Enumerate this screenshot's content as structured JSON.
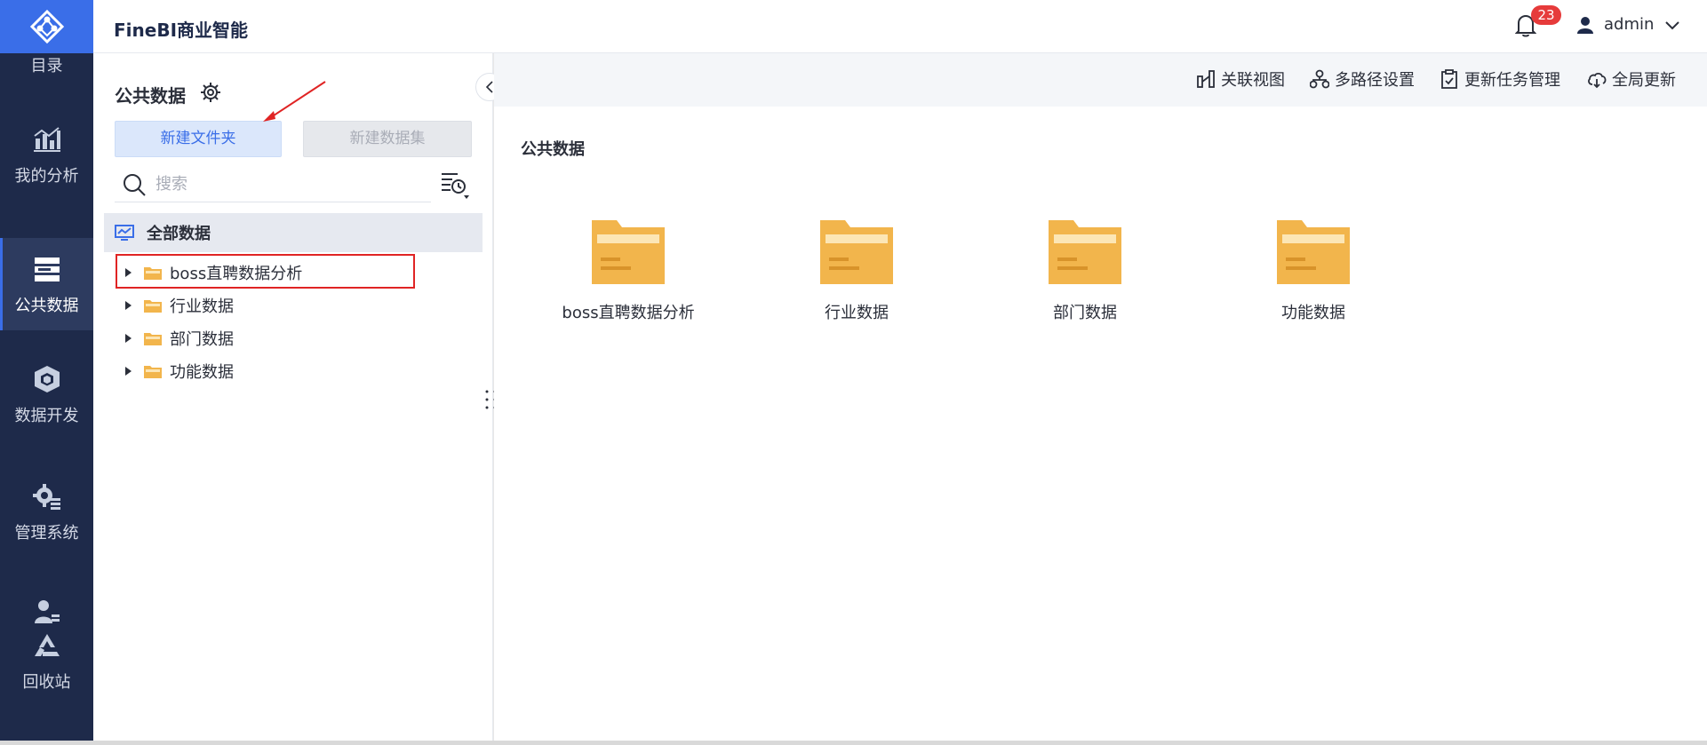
{
  "rail": {
    "catalog_label": "目录",
    "items": [
      {
        "label": "我的分析",
        "icon": "chart-icon"
      },
      {
        "label": "公共数据",
        "icon": "public-data-icon"
      },
      {
        "label": "数据开发",
        "icon": "cube-icon"
      },
      {
        "label": "管理系统",
        "icon": "gear-system-icon"
      },
      {
        "label": "回收站",
        "icon": "recycle-icon"
      }
    ]
  },
  "header": {
    "app_title": "FineBI商业智能",
    "notification_count": "23",
    "user_name": "admin"
  },
  "tree_panel": {
    "title": "公共数据",
    "new_folder_label": "新建文件夹",
    "new_dataset_label": "新建数据集",
    "search_placeholder": "搜索",
    "root_label": "全部数据",
    "items": [
      {
        "label": "boss直聘数据分析"
      },
      {
        "label": "行业数据"
      },
      {
        "label": "部门数据"
      },
      {
        "label": "功能数据"
      }
    ]
  },
  "toolbar": {
    "items": [
      {
        "label": "关联视图",
        "icon": "relation-view-icon"
      },
      {
        "label": "多路径设置",
        "icon": "multipath-icon"
      },
      {
        "label": "更新任务管理",
        "icon": "task-manage-icon"
      },
      {
        "label": "全局更新",
        "icon": "global-update-icon"
      }
    ]
  },
  "main": {
    "title": "公共数据",
    "folders": [
      {
        "label": "boss直聘数据分析"
      },
      {
        "label": "行业数据"
      },
      {
        "label": "部门数据"
      },
      {
        "label": "功能数据"
      }
    ]
  },
  "colors": {
    "rail_bg": "#1e2a4a",
    "accent": "#3a6ee8",
    "folder": "#f2b54c",
    "badge": "#e63b3b",
    "highlight": "#e02424"
  }
}
